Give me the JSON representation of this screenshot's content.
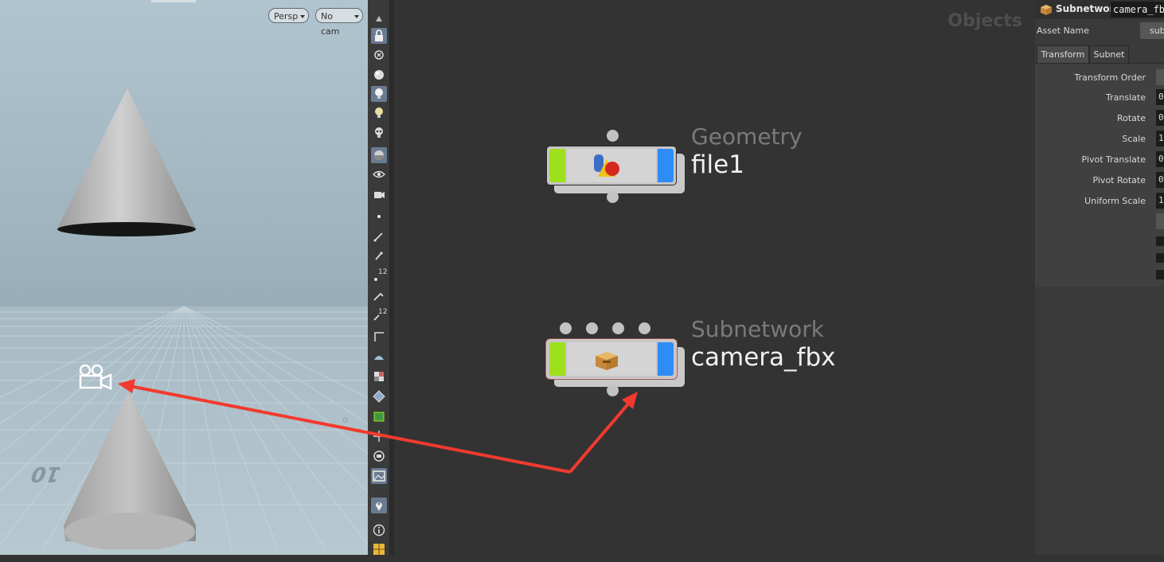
{
  "viewport": {
    "persp_label": "Persp",
    "cam_label": "No cam",
    "grid_number": "10"
  },
  "shelf": {
    "icons": [
      "scroll-up-arrow",
      "lock-icon",
      "close-circle-icon",
      "sphere-icon",
      "light-bulb-icon",
      "light-bulb-outline-icon",
      "skull-icon",
      "shaded-sphere-icon",
      "eye-icon",
      "camera-eye-icon",
      "point-icon",
      "brush-icon",
      "pen-icon",
      "number-12-icon",
      "wrench-icon",
      "number-12-alt-icon",
      "corner-icon",
      "hat-icon",
      "checker-icon",
      "cube-outline-icon",
      "green-frame-icon",
      "crosshair-icon",
      "record-icon",
      "picture-icon",
      "location-pin-icon",
      "info-icon",
      "grid-icon"
    ],
    "label_12": "12"
  },
  "network": {
    "title": "Objects",
    "nodes": [
      {
        "type": "Geometry",
        "name": "file1"
      },
      {
        "type": "Subnetwork",
        "name": "camera_fbx"
      }
    ]
  },
  "params": {
    "node_type": "Subnetwork",
    "node_name": "camera_fbx",
    "asset_name_label": "Asset Name",
    "asset_button": "sub",
    "tabs": [
      "Transform",
      "Subnet"
    ],
    "rows": [
      {
        "label": "Transform Order",
        "kind": "dropdown",
        "value": ""
      },
      {
        "label": "Translate",
        "kind": "field",
        "value": "0"
      },
      {
        "label": "Rotate",
        "kind": "field",
        "value": "0"
      },
      {
        "label": "Scale",
        "kind": "field",
        "value": "1"
      },
      {
        "label": "Pivot Translate",
        "kind": "field",
        "value": "0"
      },
      {
        "label": "Pivot Rotate",
        "kind": "field",
        "value": "0"
      },
      {
        "label": "Uniform Scale",
        "kind": "field",
        "value": "1"
      }
    ]
  },
  "colors": {
    "node_left": "#9fe01c",
    "node_right": "#2f8cf5",
    "arrow": "#f23a2e"
  }
}
